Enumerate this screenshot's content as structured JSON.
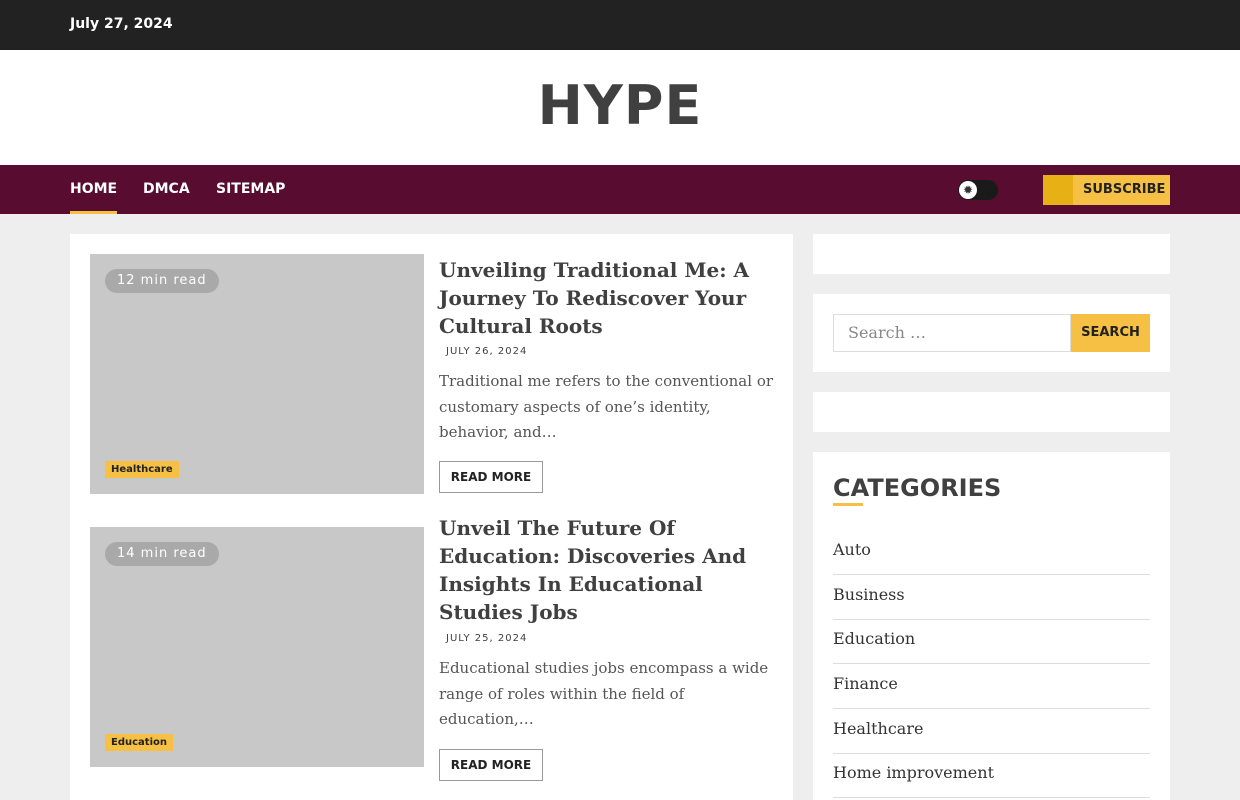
{
  "topbar": {
    "date": "July 27, 2024"
  },
  "header": {
    "site_title": "HYPE"
  },
  "nav": {
    "items": [
      "Home",
      "DMCA",
      "Sitemap"
    ],
    "subscribe_label": "Subscribe"
  },
  "posts": [
    {
      "read_time": "12 min read",
      "category": "Healthcare",
      "title": "Unveiling Traditional Me: A Journey To Rediscover Your Cultural Roots",
      "date": "JULY 26, 2024",
      "excerpt": "Traditional me refers to the conventional or customary aspects of one’s identity, behavior, and…",
      "read_more": "Read More"
    },
    {
      "read_time": "14 min read",
      "category": "Education",
      "title": "Unveil The Future Of Education: Discoveries And Insights In Educational Studies Jobs",
      "date": "JULY 25, 2024",
      "excerpt": "Educational studies jobs encompass a wide range of roles within the field of education,…",
      "read_more": "Read More"
    }
  ],
  "sidebar": {
    "search": {
      "placeholder": "Search …",
      "button": "Search"
    },
    "categories_title": "Categories",
    "categories": [
      "Auto",
      "Business",
      "Education",
      "Finance",
      "Healthcare",
      "Home improvement"
    ]
  },
  "colors": {
    "accent": "#f5c043",
    "nav_bg": "#570c30",
    "topbar_bg": "#222222"
  },
  "icons": {
    "toggle_knob": "sun-icon",
    "subscribe": "bell-icon"
  }
}
